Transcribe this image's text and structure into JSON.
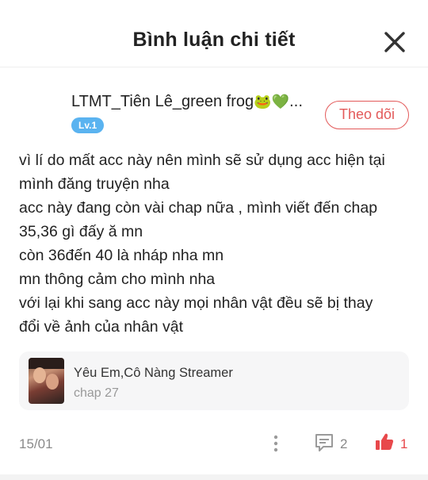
{
  "header": {
    "title": "Bình luận chi tiết"
  },
  "author": {
    "name": "LTMT_Tiên Lê_green frog",
    "name_suffix": "🐸💚...",
    "level": "Lv.1",
    "follow_label": "Theo dõi"
  },
  "comment": {
    "lines": [
      "vì lí do mất acc này nên mình sẽ sử dụng acc hiện tại",
      "mình đăng truyện nha",
      "acc này đang còn vài chap nữa , mình viết đến chap",
      "35,36 gì đấy ă mn",
      "còn 36đến 40 là nháp nha mn",
      "mn thông cảm cho mình nha",
      "với lại khi sang acc này mọi nhân vật đều sẽ bị thay",
      "đổi về ảnh của nhân vật"
    ]
  },
  "story": {
    "title": "Yêu Em,Cô Nàng Streamer",
    "chapter": "chap 27"
  },
  "footer": {
    "date": "15/01",
    "reply_count": "2",
    "like_count": "1"
  },
  "icons": {
    "close": "close-icon",
    "more": "more-vertical-icon",
    "reply": "comment-icon",
    "like": "thumbs-up-icon"
  },
  "colors": {
    "accent": "#e35a5a",
    "like": "#e8484b",
    "level_badge": "#5ab3f0",
    "card_bg": "#f6f6f7"
  }
}
